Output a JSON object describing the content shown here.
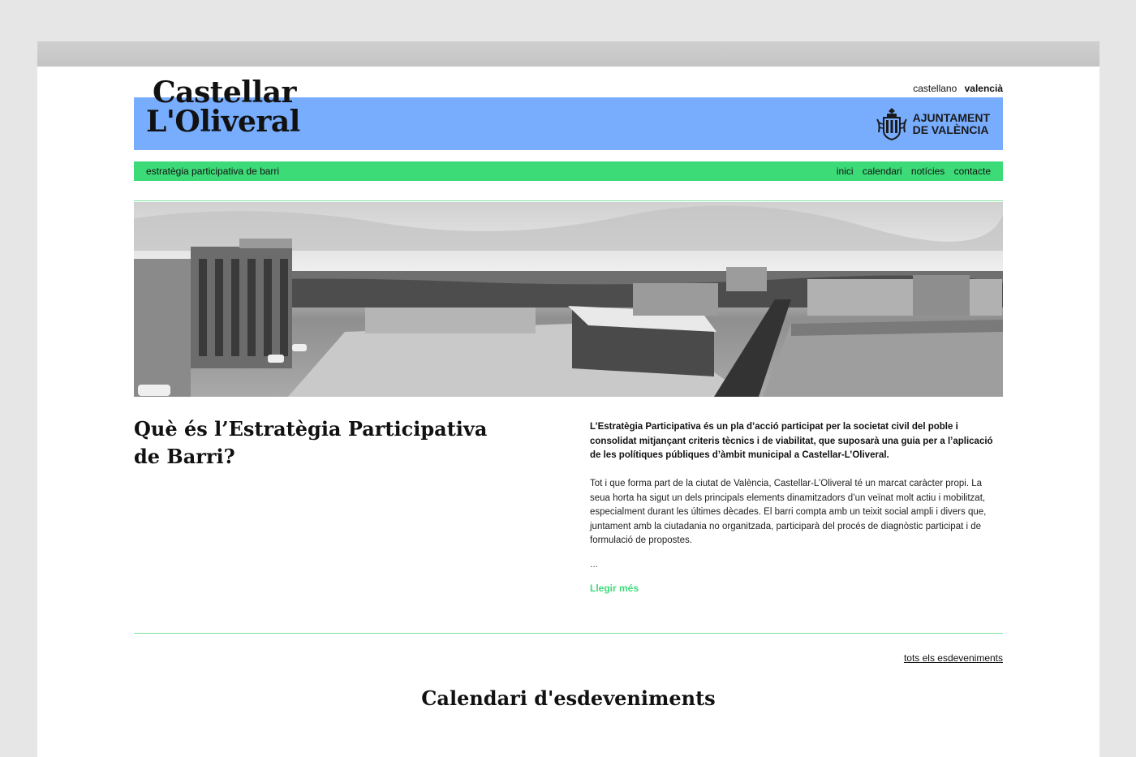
{
  "header": {
    "logo_line1": "Castellar",
    "logo_line2": "L'Oliveral",
    "lang_es": "castellano",
    "lang_va": "valencià",
    "ajuntament_line1": "AJUNTAMENT",
    "ajuntament_line2": "DE VALÈNCIA"
  },
  "nav": {
    "tagline": "estratègia participativa de barri",
    "items": [
      {
        "label": "inici"
      },
      {
        "label": "calendari"
      },
      {
        "label": "notícies"
      },
      {
        "label": "contacte"
      }
    ]
  },
  "intro": {
    "title": "Què és l’Estratègia Participativa de Barri?",
    "lead": "L’Estratègia Participativa és un pla d’acció participat per la societat civil del poble i consolidat mitjançant criteris tècnics i de viabilitat, que suposarà una guia per a l’aplicació de les polítiques públiques d’àmbit municipal a Castellar-L’Oliveral.",
    "body": "Tot i que forma part de la ciutat de València, Castellar-L’Oliveral té un marcat caràcter propi. La seua horta ha sigut un dels principals elements dinamitzadors d’un veïnat molt actiu i mobilitzat, especialment durant les últimes dècades. El barri compta amb un teixit social ampli i divers que, juntament amb la ciutadania no organitzada, participarà del procés de diagnòstic participat i de formulació de propostes.",
    "ellipsis": "...",
    "read_more": "Llegir més"
  },
  "events": {
    "all_link": "tots els esdeveniments",
    "title": "Calendari d'esdeveniments"
  },
  "colors": {
    "blue_band": "#78adfe",
    "green_nav": "#3ddb78",
    "green_rule": "#7ee39f"
  }
}
